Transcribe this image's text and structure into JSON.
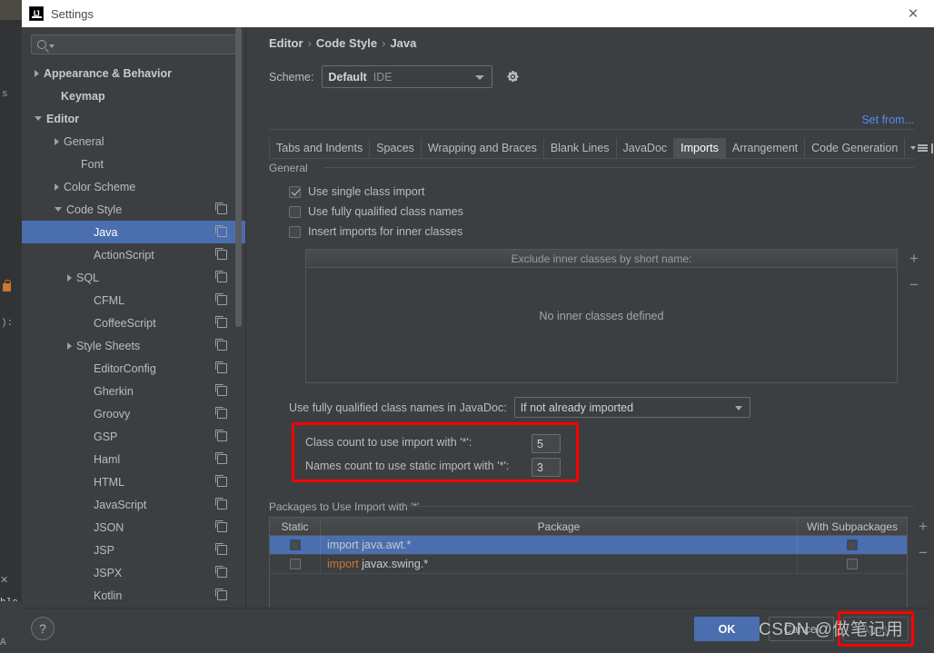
{
  "window": {
    "title": "Settings",
    "icon": "intellij-idea-icon",
    "close_label": "✕"
  },
  "sidebar": {
    "search": {
      "value": "",
      "placeholder": "",
      "icon": "search-icon"
    },
    "items": [
      {
        "label": "Appearance & Behavior",
        "indent": 14,
        "arrow": "right",
        "bold": true,
        "copy": false,
        "selected": false
      },
      {
        "label": "Keymap",
        "indent": 33,
        "arrow": "none",
        "bold": true,
        "copy": false,
        "selected": false
      },
      {
        "label": "Editor",
        "indent": 14,
        "arrow": "down",
        "bold": true,
        "copy": false,
        "selected": false
      },
      {
        "label": "General",
        "indent": 36,
        "arrow": "right",
        "bold": false,
        "copy": false,
        "selected": false
      },
      {
        "label": "Font",
        "indent": 55,
        "arrow": "none",
        "bold": false,
        "copy": false,
        "selected": false
      },
      {
        "label": "Color Scheme",
        "indent": 36,
        "arrow": "right",
        "bold": false,
        "copy": false,
        "selected": false
      },
      {
        "label": "Code Style",
        "indent": 36,
        "arrow": "down",
        "bold": false,
        "copy": true,
        "selected": false
      },
      {
        "label": "Java",
        "indent": 69,
        "arrow": "none",
        "bold": false,
        "copy": true,
        "selected": true
      },
      {
        "label": "ActionScript",
        "indent": 69,
        "arrow": "none",
        "bold": false,
        "copy": true,
        "selected": false
      },
      {
        "label": "SQL",
        "indent": 50,
        "arrow": "right",
        "bold": false,
        "copy": true,
        "selected": false
      },
      {
        "label": "CFML",
        "indent": 69,
        "arrow": "none",
        "bold": false,
        "copy": true,
        "selected": false
      },
      {
        "label": "CoffeeScript",
        "indent": 69,
        "arrow": "none",
        "bold": false,
        "copy": true,
        "selected": false
      },
      {
        "label": "Style Sheets",
        "indent": 50,
        "arrow": "right",
        "bold": false,
        "copy": true,
        "selected": false
      },
      {
        "label": "EditorConfig",
        "indent": 69,
        "arrow": "none",
        "bold": false,
        "copy": true,
        "selected": false
      },
      {
        "label": "Gherkin",
        "indent": 69,
        "arrow": "none",
        "bold": false,
        "copy": true,
        "selected": false
      },
      {
        "label": "Groovy",
        "indent": 69,
        "arrow": "none",
        "bold": false,
        "copy": true,
        "selected": false
      },
      {
        "label": "GSP",
        "indent": 69,
        "arrow": "none",
        "bold": false,
        "copy": true,
        "selected": false
      },
      {
        "label": "Haml",
        "indent": 69,
        "arrow": "none",
        "bold": false,
        "copy": true,
        "selected": false
      },
      {
        "label": "HTML",
        "indent": 69,
        "arrow": "none",
        "bold": false,
        "copy": true,
        "selected": false
      },
      {
        "label": "JavaScript",
        "indent": 69,
        "arrow": "none",
        "bold": false,
        "copy": true,
        "selected": false
      },
      {
        "label": "JSON",
        "indent": 69,
        "arrow": "none",
        "bold": false,
        "copy": true,
        "selected": false
      },
      {
        "label": "JSP",
        "indent": 69,
        "arrow": "none",
        "bold": false,
        "copy": true,
        "selected": false
      },
      {
        "label": "JSPX",
        "indent": 69,
        "arrow": "none",
        "bold": false,
        "copy": true,
        "selected": false
      },
      {
        "label": "Kotlin",
        "indent": 69,
        "arrow": "none",
        "bold": false,
        "copy": true,
        "selected": false
      }
    ]
  },
  "content": {
    "breadcrumb": {
      "parts": [
        "Editor",
        "Code Style",
        "Java"
      ],
      "separator": "›"
    },
    "scheme": {
      "label": "Scheme:",
      "value": "Default",
      "sub": "IDE",
      "gear_icon": "gear-icon"
    },
    "set_from_link": "Set from...",
    "tabs": [
      {
        "label": "Tabs and Indents",
        "active": false
      },
      {
        "label": "Spaces",
        "active": false
      },
      {
        "label": "Wrapping and Braces",
        "active": false
      },
      {
        "label": "Blank Lines",
        "active": false
      },
      {
        "label": "JavaDoc",
        "active": false
      },
      {
        "label": "Imports",
        "active": true
      },
      {
        "label": "Arrangement",
        "active": false
      },
      {
        "label": "Code Generation",
        "active": false
      }
    ],
    "general_group": {
      "title": "General",
      "checkboxes": [
        {
          "label": "Use single class import",
          "checked": true
        },
        {
          "label": "Use fully qualified class names",
          "checked": false
        },
        {
          "label": "Insert imports for inner classes",
          "checked": false
        }
      ]
    },
    "exclude_list": {
      "header": "Exclude inner classes by short name:",
      "empty_text": "No inner classes defined",
      "add_label": "+",
      "remove_label": "−"
    },
    "javadoc_fqn": {
      "label": "Use fully qualified class names in JavaDoc:",
      "value": "If not already imported"
    },
    "counts": [
      {
        "label": "Class count to use import with '*':",
        "value": "5"
      },
      {
        "label": "Names count to use static import with '*':",
        "value": "3"
      }
    ],
    "packages_group": {
      "title": "Packages to Use Import with '*'",
      "columns": [
        "Static",
        "Package",
        "With Subpackages"
      ],
      "rows": [
        {
          "static_checked": true,
          "keyword": "import",
          "package": "java.awt.*",
          "sub_checked": true,
          "selected": true,
          "keyword_colored": false
        },
        {
          "static_checked": false,
          "keyword": "import",
          "package": "javax.swing.*",
          "sub_checked": false,
          "selected": false,
          "keyword_colored": true
        }
      ],
      "add_label": "+",
      "remove_label": "−"
    }
  },
  "footer": {
    "help_label": "?",
    "ok_label": "OK",
    "cancel_label": "Cancel",
    "apply_label": "Apply"
  },
  "overlay": {
    "watermark": "CSDN @做笔记用",
    "highlight_color": "#ff0000"
  },
  "background": {
    "code_fragment": "):",
    "left_fragment_s": "s"
  }
}
